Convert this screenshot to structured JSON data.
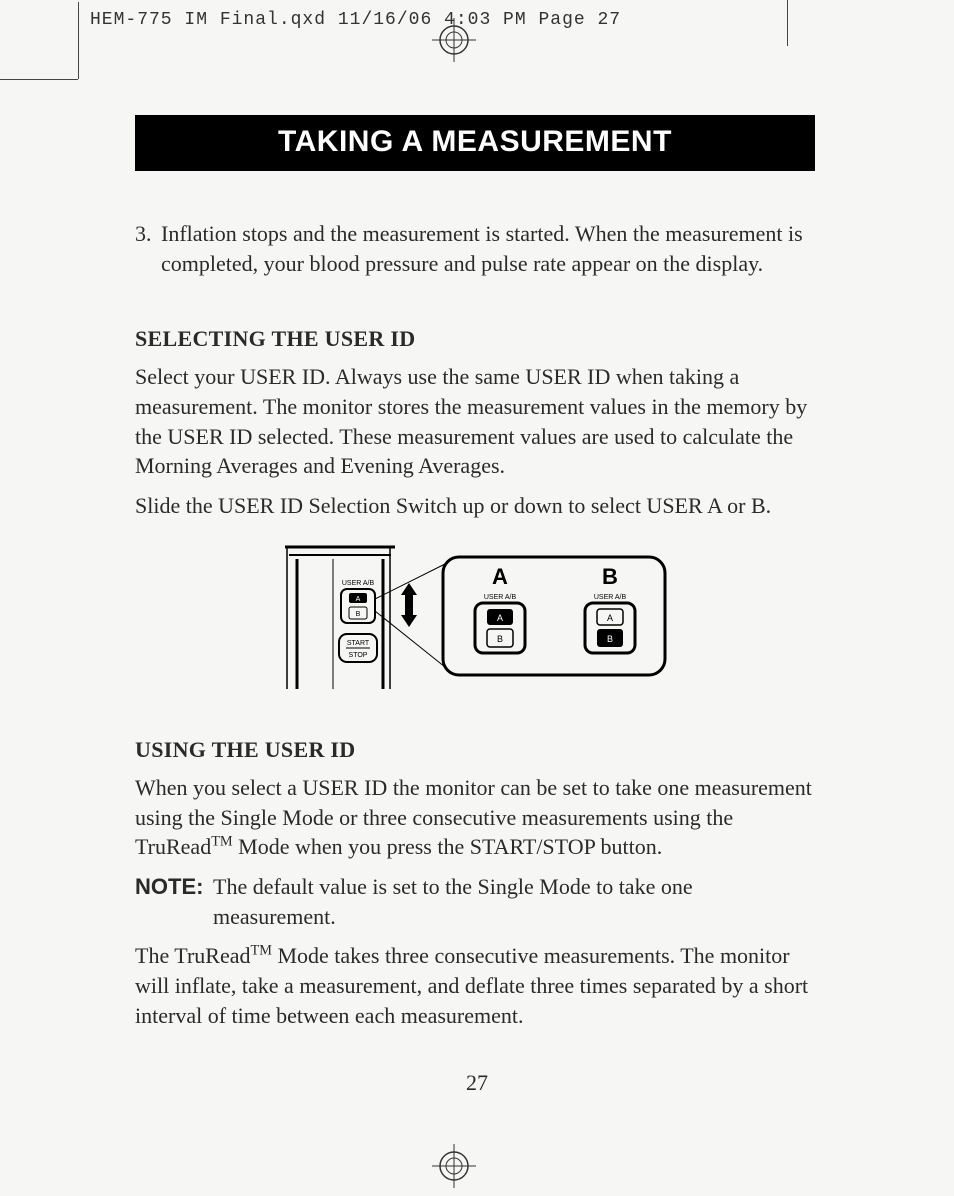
{
  "slug": "HEM-775 IM Final.qxd  11/16/06  4:03 PM  Page 27",
  "title": "TAKING A MEASUREMENT",
  "step": {
    "num": "3.",
    "text": "Inflation stops and the measurement is started. When the measurement is completed, your blood pressure and pulse rate appear on the display."
  },
  "section1": {
    "heading": "SELECTING THE USER ID",
    "p1": "Select your USER ID. Always use the same USER ID when taking a measurement. The monitor stores the measurement values in the memory by the USER ID selected. These measurement values are used to calculate the Morning Averages and Evening Averages.",
    "p2": "Slide the USER ID Selection Switch up or down to select USER A or B."
  },
  "diagram": {
    "label_user_ab": "USER A/B",
    "label_start_stop_top": "START",
    "label_start_stop_bot": "STOP",
    "A": "A",
    "B": "B"
  },
  "section2": {
    "heading": "USING THE USER ID",
    "p1_a": "When you select a USER ID the monitor can be set to take one measurement using the Single Mode or three consecutive measurements using the TruRead",
    "p1_b": " Mode when you press the START/STOP button.",
    "note_label": "NOTE:",
    "note_text": "The default value is set to the Single Mode to take one measurement.",
    "p2_a": "The TruRead",
    "p2_b": " Mode takes three consecutive measurements. The monitor will inflate, take a measurement, and deflate three times separated by a short interval of time between each measurement."
  },
  "tm": "TM",
  "page_number": "27"
}
